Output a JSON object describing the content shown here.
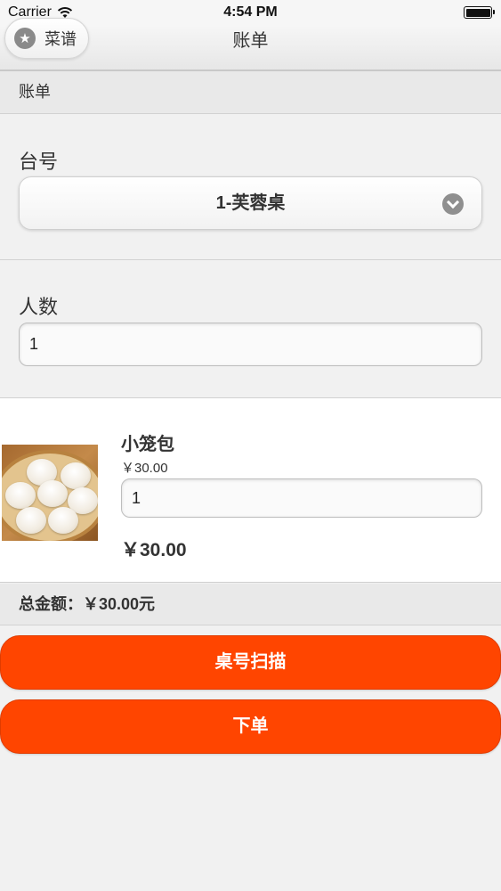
{
  "status_bar": {
    "carrier": "Carrier",
    "time": "4:54 PM"
  },
  "nav": {
    "title": "账单",
    "menu_button": {
      "label": "菜谱",
      "icon": "star-icon"
    }
  },
  "section": {
    "title": "账单"
  },
  "table": {
    "label": "台号",
    "selected": "1-芙蓉桌",
    "icon": "chevron-down-icon"
  },
  "guests": {
    "label": "人数",
    "value": "1"
  },
  "order_items": [
    {
      "name": "小笼包",
      "unit_price": "￥30.00",
      "quantity": "1",
      "subtotal": "￥30.00"
    }
  ],
  "summary": {
    "total_text": "总金额：￥30.00元"
  },
  "buttons": {
    "scan": "桌号扫描",
    "place_order": "下单"
  },
  "colors": {
    "accent": "#ff4500",
    "background": "#f1f1f1"
  }
}
